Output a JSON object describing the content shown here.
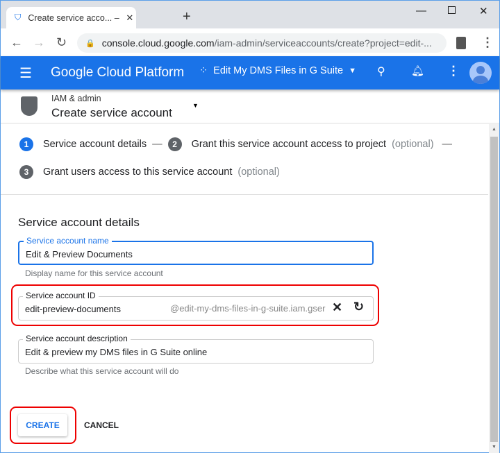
{
  "browser": {
    "tab_title": "Create service acco... – IAM & admin",
    "url_host": "console.cloud.google.com",
    "url_path": "/iam-admin/serviceaccounts/create?project=edit-..."
  },
  "header": {
    "brand": "Google Cloud Platform",
    "project": "Edit My DMS Files in G Suite"
  },
  "subheader": {
    "section": "IAM & admin",
    "title": "Create service account"
  },
  "steps": [
    {
      "num": "1",
      "label": "Service account details",
      "optional": "",
      "active": true
    },
    {
      "num": "2",
      "label": "Grant this service account access to project",
      "optional": "(optional)",
      "active": false
    },
    {
      "num": "3",
      "label": "Grant users access to this service account",
      "optional": "(optional)",
      "active": false
    }
  ],
  "form": {
    "title": "Service account details",
    "name": {
      "label": "Service account name",
      "value": "Edit & Preview Documents",
      "hint": "Display name for this service account"
    },
    "id": {
      "label": "Service account ID",
      "value": "edit-preview-documents",
      "suffix": "@edit-my-dms-files-in-g-suite.iam.gser"
    },
    "description": {
      "label": "Service account description",
      "value": "Edit & preview my DMS files in G Suite online",
      "hint": "Describe what this service account will do"
    },
    "create_label": "CREATE",
    "cancel_label": "CANCEL"
  },
  "colors": {
    "brand": "#1a73e8",
    "highlight": "#e00000"
  }
}
